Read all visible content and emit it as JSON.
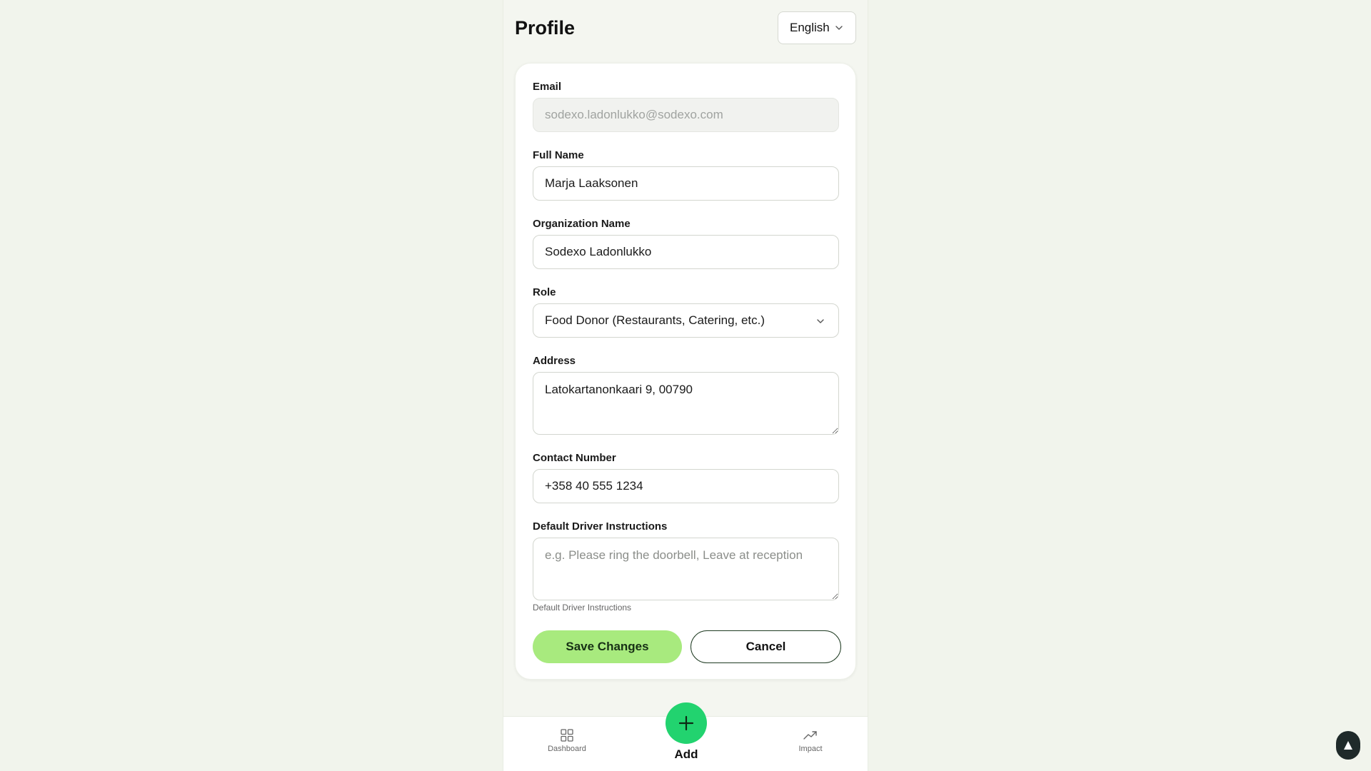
{
  "header": {
    "title": "Profile",
    "language": "English"
  },
  "form": {
    "email": {
      "label": "Email",
      "value": "sodexo.ladonlukko@sodexo.com"
    },
    "full_name": {
      "label": "Full Name",
      "value": "Marja Laaksonen"
    },
    "organization": {
      "label": "Organization Name",
      "value": "Sodexo Ladonlukko"
    },
    "role": {
      "label": "Role",
      "value": "Food Donor (Restaurants, Catering, etc.)"
    },
    "address": {
      "label": "Address",
      "value": "Latokartanonkaari 9, 00790"
    },
    "contact": {
      "label": "Contact Number",
      "value": "+358 40 555 1234"
    },
    "driver_instructions": {
      "label": "Default Driver Instructions",
      "placeholder": "e.g. Please ring the doorbell, Leave at reception",
      "hint": "Default Driver Instructions"
    },
    "save_label": "Save Changes",
    "cancel_label": "Cancel"
  },
  "nav": {
    "dashboard_label": "Dashboard",
    "add_label": "Add",
    "impact_label": "Impact"
  },
  "colors": {
    "save_button": "#a8ea7e",
    "fab": "#22d36f",
    "background": "#f1f4ec"
  },
  "icons": {
    "language_chevron": "chevron-down-icon",
    "role_chevron": "chevron-down-icon",
    "dashboard": "grid-icon",
    "add": "plus-icon",
    "impact": "trending-up-icon",
    "scroll_top": "triangle-up-icon"
  }
}
